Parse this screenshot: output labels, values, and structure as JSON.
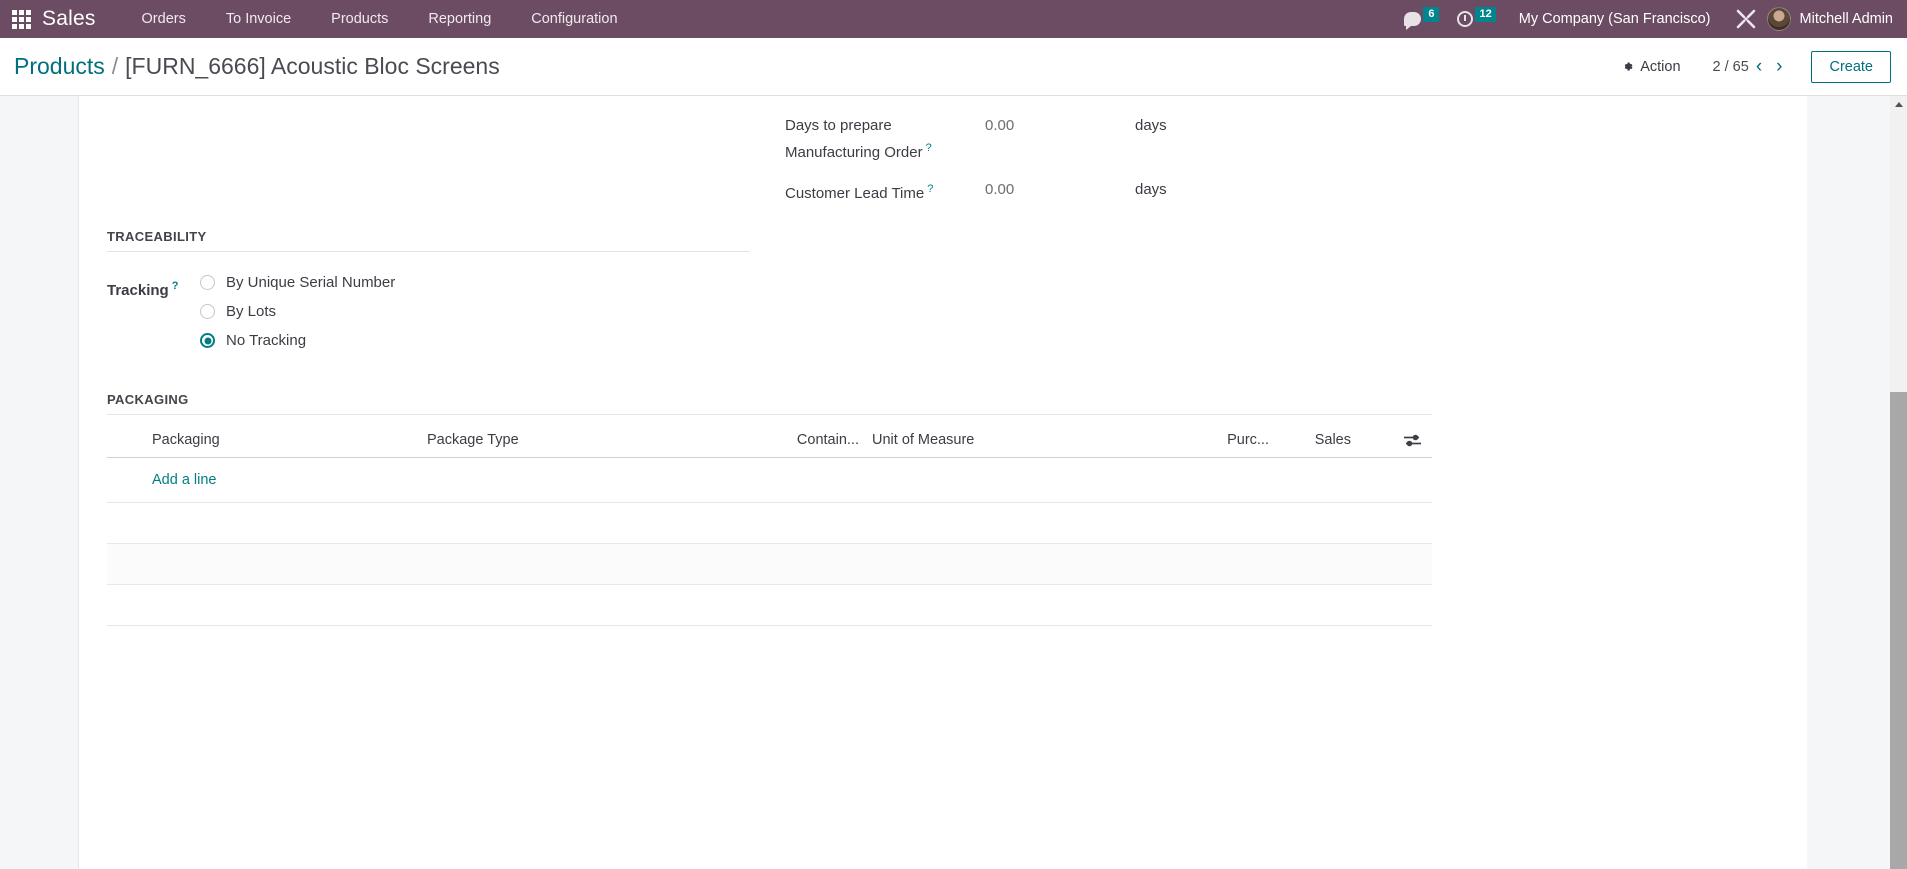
{
  "navbar": {
    "apps_icon": "apps-grid-icon",
    "brand": "Sales",
    "menu": [
      {
        "label": "Orders"
      },
      {
        "label": "To Invoice"
      },
      {
        "label": "Products"
      },
      {
        "label": "Reporting"
      },
      {
        "label": "Configuration"
      }
    ],
    "messages_icon": "chat-bubble-icon",
    "messages_count": "6",
    "activities_icon": "clock-icon",
    "activities_count": "12",
    "company": "My Company (San Francisco)",
    "debug_icon": "tools-icon",
    "avatar_icon": "user-avatar",
    "user": "Mitchell Admin",
    "bg_color": "#6c4c63",
    "badge_color": "#00848e"
  },
  "control_panel": {
    "breadcrumb_root": "Products",
    "breadcrumb_separator": "/",
    "breadcrumb_current": "[FURN_6666] Acoustic Bloc Screens",
    "action_label": "Action",
    "action_icon": "gear-icon",
    "pager": "2 / 65",
    "prev_icon": "chevron-left-icon",
    "prev_glyph": "‹",
    "next_icon": "chevron-right-icon",
    "next_glyph": "›",
    "create_label": "Create",
    "accent_color": "#00707f"
  },
  "form": {
    "top_fields": [
      {
        "label": "Days to prepare Manufacturing Order",
        "help": "?",
        "value": "0.00",
        "unit": "days"
      },
      {
        "label": "Customer Lead Time",
        "help": "?",
        "value": "0.00",
        "unit": "days"
      }
    ],
    "traceability": {
      "title": "TRACEABILITY",
      "tracking_label": "Tracking",
      "tracking_help": "?",
      "options": [
        {
          "label": "By Unique Serial Number",
          "selected": false
        },
        {
          "label": "By Lots",
          "selected": false
        },
        {
          "label": "No Tracking",
          "selected": true
        }
      ],
      "selected_color": "#017e84"
    },
    "packaging": {
      "title": "PACKAGING",
      "columns": [
        "Packaging",
        "Package Type",
        "Contain...",
        "Unit of Measure",
        "Purc...",
        "Sales"
      ],
      "optional_columns_icon": "sliders-icon",
      "rows": [],
      "add_line_label": "Add a line"
    }
  },
  "scrollbar": {
    "up_arrow_icon": "scroll-up-arrow-icon",
    "thumb_name": "scrollbar-thumb"
  }
}
